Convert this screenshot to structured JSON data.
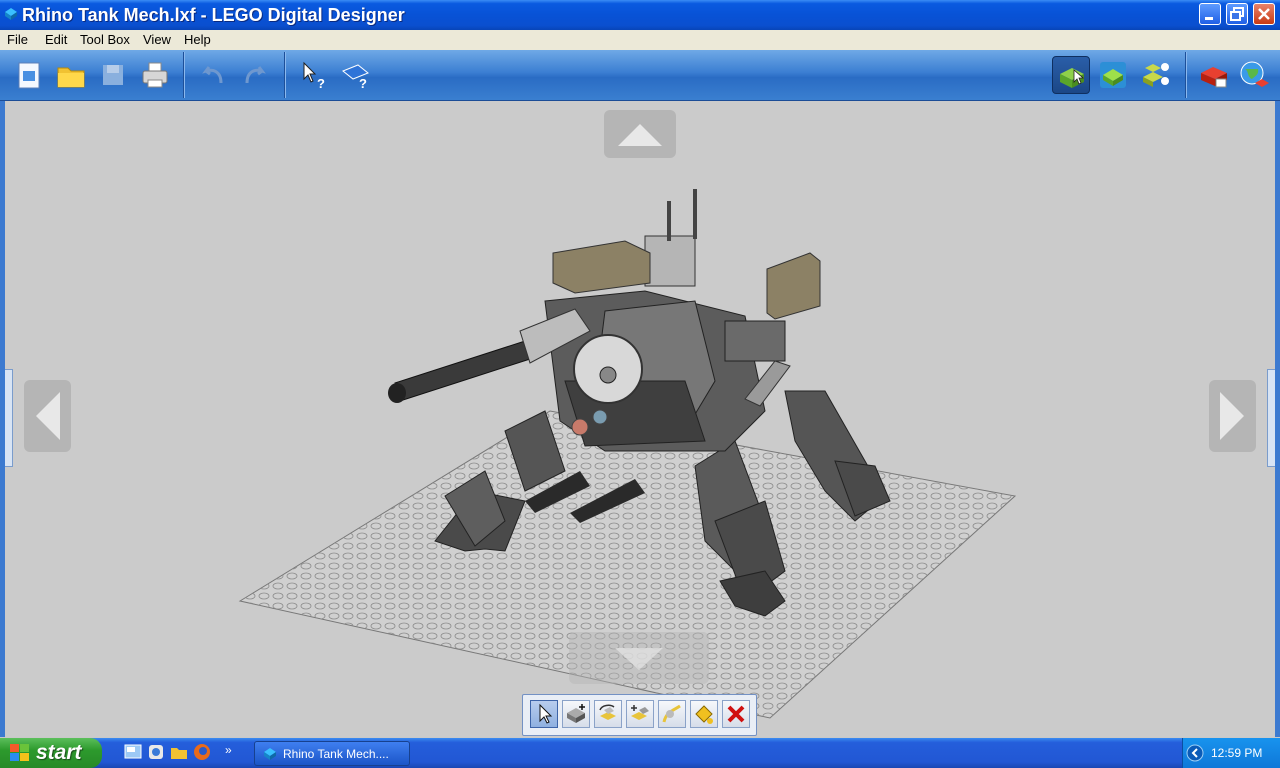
{
  "window": {
    "title": "Rhino Tank Mech.lxf - LEGO Digital Designer"
  },
  "menu": [
    "File",
    "Edit",
    "Tool Box",
    "View",
    "Help"
  ],
  "toolbar": {
    "left_buttons": [
      "new-file",
      "open-folder",
      "save-disk",
      "print",
      "undo",
      "redo",
      "select-help",
      "building-guide-help"
    ],
    "mode_buttons": [
      "build-mode",
      "view-mode",
      "building-guide-mode"
    ],
    "right_buttons": [
      "lego-brick-shop",
      "lego-website-upload"
    ]
  },
  "tools": [
    "select",
    "clone",
    "hinge",
    "hinge-align",
    "flex",
    "paint",
    "delete"
  ],
  "taskbar": {
    "start_label": "start",
    "task_label": "Rhino Tank Mech....",
    "clock": "12:59 PM"
  },
  "colors": {
    "title_blue": "#0852d6",
    "toolbar_blue": "#3b7ed2",
    "viewport_gray": "#cbcbcb",
    "start_green": "#2d9a2d"
  }
}
